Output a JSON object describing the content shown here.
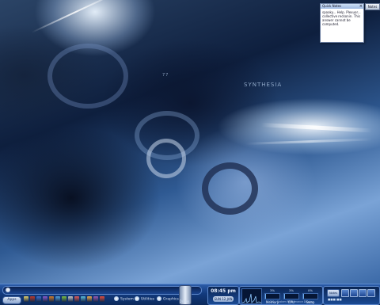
{
  "desktop": {
    "wallpaper_text_left": "",
    "wallpaper_text_right": "SYNTHESIA",
    "wallpaper_number": "77"
  },
  "sticky_note": {
    "title": "Quick Notes",
    "close_glyph": "×",
    "body": "spooky... Help. Plexuor... collective reckonin. This answer cannot be computed.",
    "notes_button": "Notes"
  },
  "taskbar": {
    "apps_label": "Apps",
    "quicklaunch_colors": [
      "#e6d36a",
      "#c0392b",
      "#3b6fd1",
      "#8a5bd1",
      "#d47e2b",
      "#4fa3e0",
      "#7bc043",
      "#c9c9c9",
      "#e05b5b",
      "#5bc0de",
      "#f0ad4e",
      "#9b59b6",
      "#e74c3c"
    ],
    "groups": [
      {
        "label": "System"
      },
      {
        "label": "Utilities"
      },
      {
        "label": "Graphics"
      }
    ],
    "drive_label": "Drives",
    "clock": {
      "time": "08:45 pm",
      "date": "SUN 12 JAN"
    },
    "performance": {
      "meters": [
        {
          "label": "Memory",
          "percent": "3%",
          "level": 0.03
        },
        {
          "label": "CPU",
          "percent": "3%",
          "level": 0.03
        },
        {
          "label": "Swap",
          "percent": "0%",
          "level": 0.0
        }
      ],
      "caption": "001 - System Performance Display"
    },
    "tray": {
      "button_label": "Notes",
      "status": "■■■ ■■"
    }
  }
}
